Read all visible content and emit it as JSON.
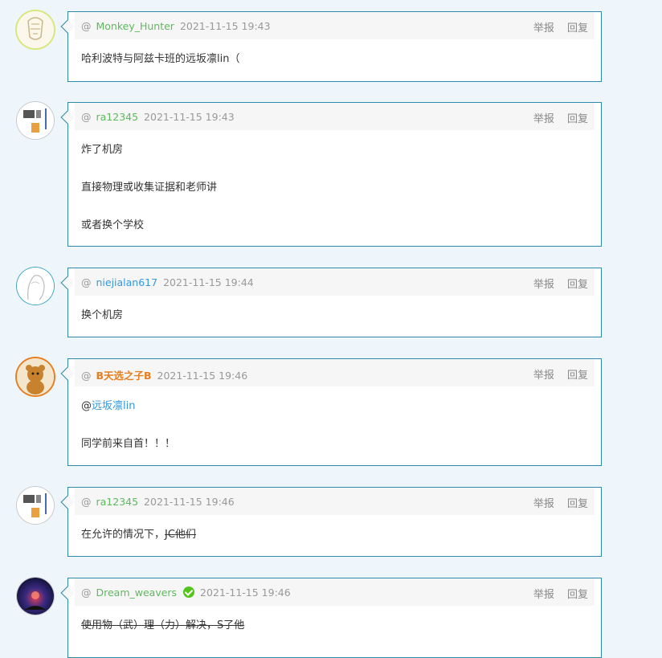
{
  "actions": {
    "report": "举报",
    "reply": "回复"
  },
  "at_symbol": "@",
  "posts": [
    {
      "user": "Monkey_Hunter",
      "time": "2021-11-15 19:43",
      "lines": [
        "哈利波特与阿兹卡班的远坂凛lin（"
      ]
    },
    {
      "user": "ra12345",
      "time": "2021-11-15 19:43",
      "lines": [
        "炸了机房",
        "直接物理或收集证据和老师讲",
        "或者换个学校"
      ]
    },
    {
      "user": "niejialan617",
      "time": "2021-11-15 19:44",
      "lines": [
        "换个机房"
      ]
    },
    {
      "user": "B天选之子B",
      "time": "2021-11-15 19:46",
      "mention_prefix": "@",
      "mention": "远坂凛lin",
      "lines": [
        "同学前来自首！！！"
      ]
    },
    {
      "user": "ra12345",
      "time": "2021-11-15 19:46",
      "line_normal": "在允许的情况下，",
      "line_strike": "JC他们"
    },
    {
      "user": "Dream_weavers",
      "time": "2021-11-15 19:46",
      "line_strike": "使用物（武）理（力）解决，S了他"
    }
  ],
  "colors": {
    "border": "#2d8aa8",
    "green_name": "#5eb95e",
    "blue_name": "#3498db",
    "orange_name": "#e67e22",
    "verified": "#52c41a"
  }
}
